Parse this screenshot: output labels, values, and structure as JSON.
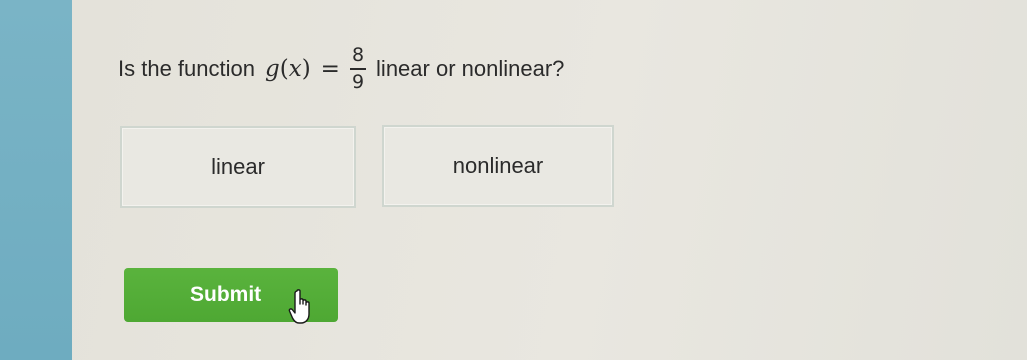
{
  "question": {
    "prefix": "Is the function",
    "function_name": "g",
    "variable": "x",
    "equals": "=",
    "numerator": "8",
    "denominator": "9",
    "suffix": "linear or nonlinear?"
  },
  "choices": [
    {
      "label": "linear"
    },
    {
      "label": "nonlinear"
    }
  ],
  "submit": {
    "label": "Submit",
    "color": "#55ae38"
  },
  "colors": {
    "sidebar": "#74b0c3",
    "background": "#e6e4dd"
  },
  "icons": {
    "cursor": "hand-pointer-icon"
  }
}
